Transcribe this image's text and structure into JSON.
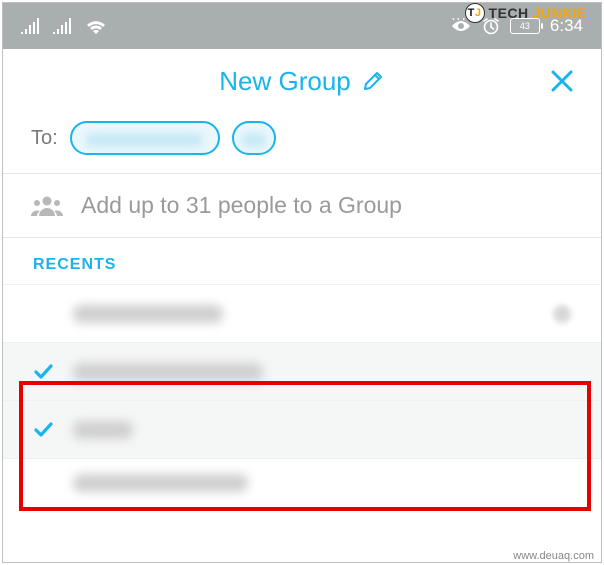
{
  "statusbar": {
    "time": "6:34",
    "battery_text": "43"
  },
  "header": {
    "title": "New Group"
  },
  "to": {
    "label": "To:"
  },
  "add_row": {
    "text": "Add up to 31 people to a Group"
  },
  "section": {
    "recents_label": "RECENTS"
  },
  "watermarks": {
    "tj_text_1": "TECH",
    "tj_text_2": "JUNKIE",
    "footer": "www.deuaq.com"
  }
}
